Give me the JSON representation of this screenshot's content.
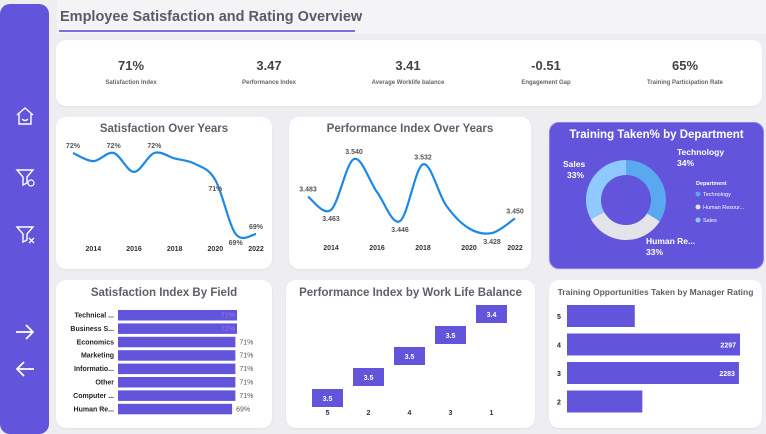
{
  "page": {
    "title": "Employee Satisfaction and Rating Overview"
  },
  "kpis": [
    {
      "value": "71%",
      "label": "Satisfaction Index"
    },
    {
      "value": "3.47",
      "label": "Performance Index"
    },
    {
      "value": "3.41",
      "label": "Average Worklife balance"
    },
    {
      "value": "-0.51",
      "label": "Engagement Gap"
    },
    {
      "value": "65%",
      "label": "Training Participation Rate"
    }
  ],
  "sidebar": {
    "icons": [
      "home-icon",
      "filter-icon",
      "clear-filter-icon",
      "arrow-right-icon",
      "arrow-left-icon"
    ]
  },
  "colors": {
    "accent": "#6354dc",
    "line": "#1e88e5",
    "bar": "#6354dc",
    "donut_light": "#8ec9ff",
    "donut_mid": "#5aa8f0",
    "donut_grey": "#e3e3ea"
  },
  "chart_data": [
    {
      "type": "line",
      "title": "Satisfaction Over Years",
      "xticks": [
        "2014",
        "2016",
        "2018",
        "2020",
        "2022"
      ],
      "x": [
        2013,
        2014,
        2015,
        2016,
        2017,
        2018,
        2019,
        2020,
        2021,
        2022
      ],
      "y": [
        72,
        71.7,
        72,
        71.3,
        72,
        71.8,
        71.6,
        71,
        69,
        69
      ],
      "point_labels": [
        {
          "i": 0,
          "text": "72%"
        },
        {
          "i": 2,
          "text": "72%"
        },
        {
          "i": 4,
          "text": "72%"
        },
        {
          "i": 7,
          "text": "71%"
        },
        {
          "i": 8,
          "text": "69%"
        },
        {
          "i": 9,
          "text": "69%"
        }
      ]
    },
    {
      "type": "line",
      "title": "Performance Index Over Years",
      "xticks": [
        "2014",
        "2016",
        "2018",
        "2020",
        "2022"
      ],
      "x": [
        2013,
        2014,
        2015,
        2016,
        2017,
        2018,
        2019,
        2020,
        2021,
        2022
      ],
      "y": [
        3.483,
        3.463,
        3.54,
        3.49,
        3.446,
        3.532,
        3.47,
        3.435,
        3.428,
        3.45
      ],
      "point_labels": [
        {
          "i": 0,
          "text": "3.483"
        },
        {
          "i": 1,
          "text": "3.463"
        },
        {
          "i": 2,
          "text": "3.540"
        },
        {
          "i": 4,
          "text": "3.446"
        },
        {
          "i": 5,
          "text": "3.532"
        },
        {
          "i": 8,
          "text": "3.428"
        },
        {
          "i": 9,
          "text": "3.450"
        }
      ]
    },
    {
      "type": "pie",
      "title": "Training Taken% by Department",
      "legend_title": "Department",
      "legend": [
        "Technology",
        "Human Resour...",
        "Sales"
      ],
      "slices": [
        {
          "name": "Technology",
          "value": 34,
          "label": "Technology",
          "pct": "34%"
        },
        {
          "name": "Human Resources",
          "value": 33,
          "label": "Human Re...",
          "pct": "33%"
        },
        {
          "name": "Sales",
          "value": 33,
          "label": "Sales",
          "pct": "33%"
        }
      ]
    },
    {
      "type": "bar",
      "title": "Satisfaction Index By Field",
      "orientation": "horizontal",
      "categories": [
        "Technical ...",
        "Business S...",
        "Economics",
        "Marketing",
        "Informatio...",
        "Other",
        "Computer ...",
        "Human Re..."
      ],
      "values": [
        72,
        72,
        71,
        71,
        71,
        71,
        71,
        69
      ],
      "labels": [
        "72%",
        "72%",
        "71%",
        "71%",
        "71%",
        "71%",
        "71%",
        "69%"
      ]
    },
    {
      "type": "bar",
      "title": "Performance Index by Work Life Balance",
      "subtype": "waterfall",
      "categories": [
        "5",
        "2",
        "4",
        "3",
        "1"
      ],
      "values": [
        3.5,
        3.5,
        3.5,
        3.5,
        3.4
      ],
      "labels": [
        "3.5",
        "3.5",
        "3.5",
        "3.5",
        "3.4"
      ]
    },
    {
      "type": "bar",
      "title": "Training Opportunities Taken by Manager Rating",
      "orientation": "horizontal",
      "categories": [
        "5",
        "4",
        "3",
        "2"
      ],
      "values": [
        900,
        2297,
        2283,
        1000
      ],
      "labels": [
        "",
        "2297",
        "2283",
        ""
      ]
    }
  ]
}
